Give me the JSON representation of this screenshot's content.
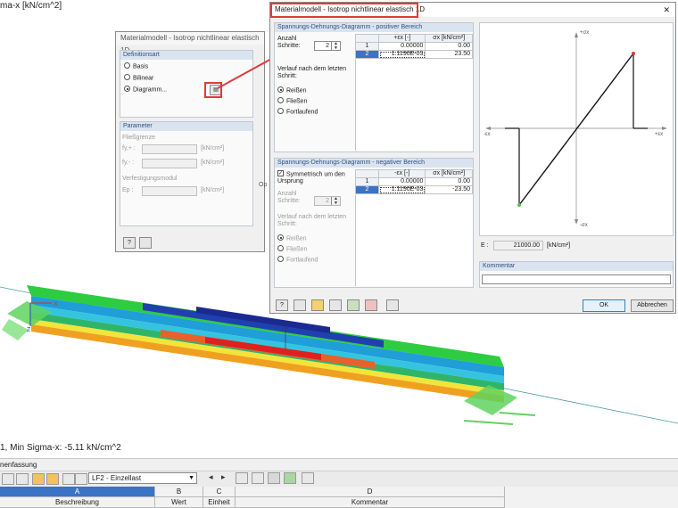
{
  "viewport": {
    "title": "ma-x [kN/cm^2]",
    "status": "1, Min Sigma-x: -5.11 kN/cm^2"
  },
  "bottom_panel": {
    "title": "nenfassung",
    "load_case": "LF2 - Einzellast",
    "columns": [
      {
        "letter": "A",
        "name": "Beschreibung"
      },
      {
        "letter": "B",
        "name": "Wert"
      },
      {
        "letter": "C",
        "name": "Einheit"
      },
      {
        "letter": "D",
        "name": "Kommentar"
      }
    ]
  },
  "back_dialog": {
    "title": "Materialmodell - Isotrop nichtlinear elastisch 1D",
    "definition_head": "Definitionsart",
    "options": [
      "Basis",
      "Bilinear",
      "Diagramm..."
    ],
    "selected_option": 2,
    "parameter_head": "Parameter",
    "yield_label": "Fließgrenze",
    "fy_plus": "fy,+ :",
    "fy_minus": "fy,- :",
    "unit_kn_cm2": "[kN/cm²]",
    "hardening_label": "Verfestigungsmodul",
    "ep_label": "Ep :",
    "op_stub": "Op"
  },
  "front_dialog": {
    "title": "Materialmodell - Isotrop nichtlinear elastisch 1D",
    "close_glyph": "✕",
    "pos_head": "Spannungs-Dehnungs-Diagramm - positiver Bereich",
    "steps_label": "Anzahl Schritte:",
    "steps_value": "2",
    "after_label": "Verlauf nach dem letzten Schritt:",
    "after_options": [
      "Reißen",
      "Fließen",
      "Fortlaufend"
    ],
    "after_selected": 0,
    "col_eps": "+εx [-]",
    "col_sigma": "σx [kN/cm²]",
    "pos_rows": [
      {
        "n": "1",
        "eps": "0.00000",
        "sigma": "0.00"
      },
      {
        "n": "2",
        "eps": "1.1190E-03",
        "sigma": "23.50"
      }
    ],
    "neg_head": "Spannungs-Dehnungs-Diagramm - negativer Bereich",
    "symmetric_label": "Symmetrisch um den Ursprung",
    "neg_steps_label": "Anzahl Schritte:",
    "neg_steps_value": "2",
    "neg_after_label": "Verlauf nach dem letzten Schritt:",
    "neg_col_eps": "-εx [-]",
    "neg_col_sigma": "σx [kN/cm²]",
    "neg_rows": [
      {
        "n": "1",
        "eps": "0.00000",
        "sigma": "0.00"
      },
      {
        "n": "2",
        "eps": "1.1190E-03",
        "sigma": "-23.50"
      }
    ],
    "diagram": {
      "top_label": "+σx",
      "bottom_label": "-σx",
      "left_label": "-εx",
      "right_label": "+εx"
    },
    "e_label": "E :",
    "e_value": "21000.00",
    "e_unit": "[kN/cm²]",
    "comment_label": "Kommentar",
    "ok_label": "OK",
    "cancel_label": "Abbrechen"
  },
  "colors": {
    "accent": "#3b73c5",
    "annotation": "#e03a3a",
    "support": "#5fd35f"
  }
}
